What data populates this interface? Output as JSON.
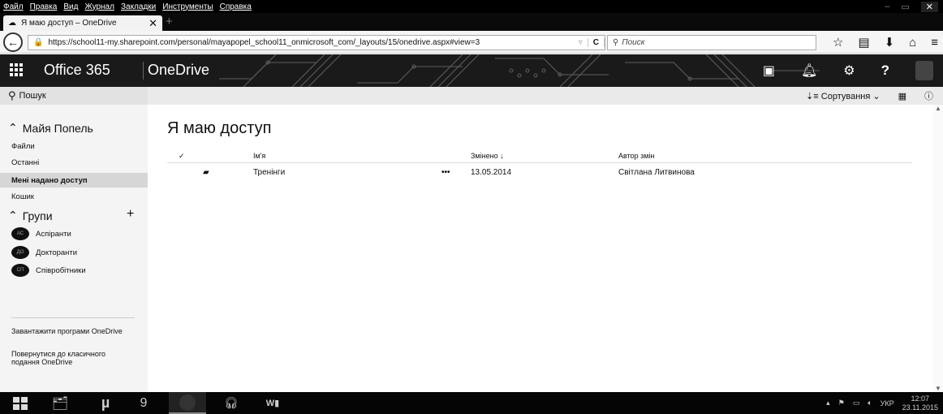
{
  "browser": {
    "menu": [
      "Файл",
      "Правка",
      "Вид",
      "Журнал",
      "Закладки",
      "Инструменты",
      "Справка"
    ],
    "tab_title": "Я маю доступ – OneDrive",
    "url": "https://school11-my.sharepoint.com/personal/mayapopel_school11_onmicrosoft_com/_layouts/15/onedrive.aspx#view=3",
    "search_placeholder": "Поиск"
  },
  "suite": {
    "title": "Office 365",
    "app": "OneDrive"
  },
  "command": {
    "search_label": "Пошук",
    "sort_label": "Сортування"
  },
  "nav": {
    "user": "Майя Попель",
    "links": [
      "Файли",
      "Останні",
      "Мені надано доступ",
      "Кошик"
    ],
    "groups_title": "Групи",
    "groups": [
      {
        "initials": "АС",
        "name": "Аспіранти"
      },
      {
        "initials": "ДО",
        "name": "Докторанти"
      },
      {
        "initials": "СП",
        "name": "Співробітники"
      }
    ],
    "footer": [
      "Завантажити програми OneDrive",
      "Повернутися до класичного подання OneDrive"
    ]
  },
  "main": {
    "title": "Я маю доступ",
    "columns": {
      "name": "Ім'я",
      "modified": "Змінено ↓",
      "author": "Автор змін"
    },
    "rows": [
      {
        "name": "Тренінги",
        "modified": "13.05.2014",
        "author": "Світлана Литвинова"
      }
    ]
  },
  "taskbar": {
    "lang": "УКР",
    "time": "12:07",
    "date": "23.11.2015"
  }
}
